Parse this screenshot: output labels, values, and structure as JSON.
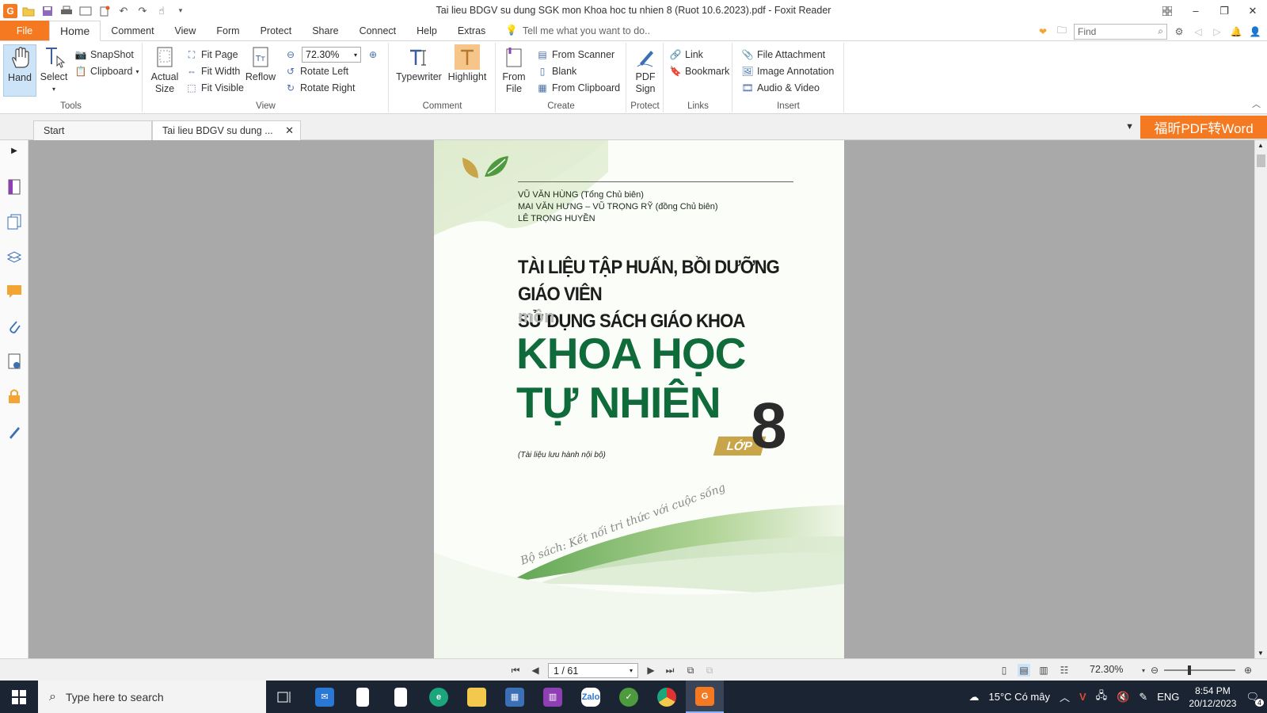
{
  "window": {
    "title": "Tai lieu BDGV su dung SGK mon Khoa hoc tu nhien 8 (Ruot 10.6.2023).pdf - Foxit Reader"
  },
  "ribbon_tabs": {
    "file": "File",
    "tabs": [
      "Home",
      "Comment",
      "View",
      "Form",
      "Protect",
      "Share",
      "Connect",
      "Help",
      "Extras"
    ],
    "tell_me": "Tell me what you want to do..",
    "find_placeholder": "Find"
  },
  "ribbon": {
    "tools": {
      "hand": "Hand",
      "select": "Select",
      "snapshot": "SnapShot",
      "clipboard": "Clipboard",
      "label": "Tools"
    },
    "view": {
      "actual_size_1": "Actual",
      "actual_size_2": "Size",
      "fit_page": "Fit Page",
      "fit_width": "Fit Width",
      "fit_visible": "Fit Visible",
      "reflow": "Reflow",
      "zoom": "72.30%",
      "rotate_left": "Rotate Left",
      "rotate_right": "Rotate Right",
      "label": "View"
    },
    "comment": {
      "typewriter": "Typewriter",
      "highlight": "Highlight",
      "label": "Comment"
    },
    "create": {
      "from_file_1": "From",
      "from_file_2": "File",
      "from_scanner": "From Scanner",
      "blank": "Blank",
      "from_clipboard": "From Clipboard",
      "label": "Create"
    },
    "protect": {
      "pdf_sign_1": "PDF",
      "pdf_sign_2": "Sign",
      "label": "Protect"
    },
    "links": {
      "link": "Link",
      "bookmark": "Bookmark",
      "label": "Links"
    },
    "insert": {
      "file_attachment": "File Attachment",
      "image_annotation": "Image Annotation",
      "audio_video": "Audio & Video",
      "label": "Insert"
    }
  },
  "doc_tabs": {
    "start": "Start",
    "active": "Tai lieu BDGV su dung ...",
    "promo": "福昕PDF转Word"
  },
  "pdf_page": {
    "author1": "VŨ VĂN HÙNG (Tổng Chủ biên)",
    "author2": "MAI VĂN HƯNG – VŨ TRỌNG RỸ (đồng Chủ biên)",
    "author3": "LÊ TRỌNG HUYỀN",
    "title_line1": "TÀI LIỆU TẬP HUẤN, BỒI DƯỠNG GIÁO VIÊN",
    "title_line2": "SỬ DỤNG SÁCH GIÁO KHOA",
    "mon": "môn",
    "subject_line1": "KHOA HỌC",
    "subject_line2": "TỰ NHIÊN",
    "lop": "LỚP",
    "grade": "8",
    "internal_note": "(Tài liệu lưu hành nội bộ)",
    "series": "Bộ sách: Kết nối tri thức với cuộc sống"
  },
  "status": {
    "page": "1 / 61",
    "zoom": "72.30%"
  },
  "taskbar": {
    "search_placeholder": "Type here to search",
    "weather": "15°C  Có mây",
    "lang": "ENG",
    "time": "8:54 PM",
    "date": "20/12/2023",
    "notifications": "4"
  },
  "colors": {
    "accent": "#f47920",
    "subject_green": "#0f6b3a",
    "workspace_gray": "#a9a9a9"
  }
}
